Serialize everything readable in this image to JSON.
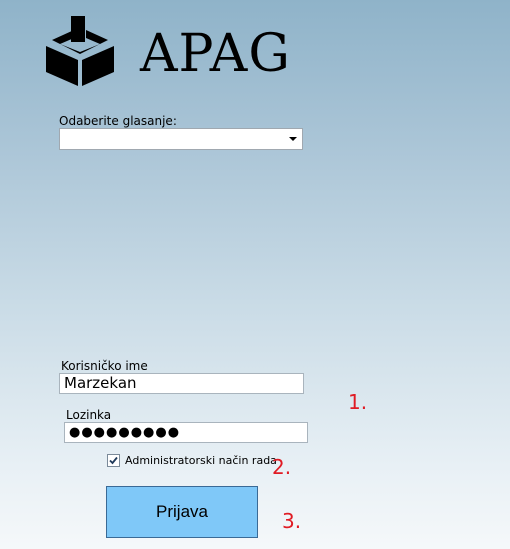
{
  "app": {
    "logo_text": "APAG",
    "logo_icon": "ballot-box-icon"
  },
  "voting": {
    "label": "Odaberite glasanje:",
    "selected_value": ""
  },
  "login": {
    "username_label": "Korisničko ime",
    "username_value": "Marzekan",
    "password_label": "Lozinka",
    "password_value": "●●●●●●●●●",
    "admin_mode_label": "Administratorski način rada",
    "admin_mode_checked": true,
    "submit_label": "Prijava"
  },
  "annotations": {
    "step1": "1.",
    "step2": "2.",
    "step3": "3."
  },
  "colors": {
    "button_fill": "#7fc8f8",
    "annotation_red": "#e01b24"
  }
}
